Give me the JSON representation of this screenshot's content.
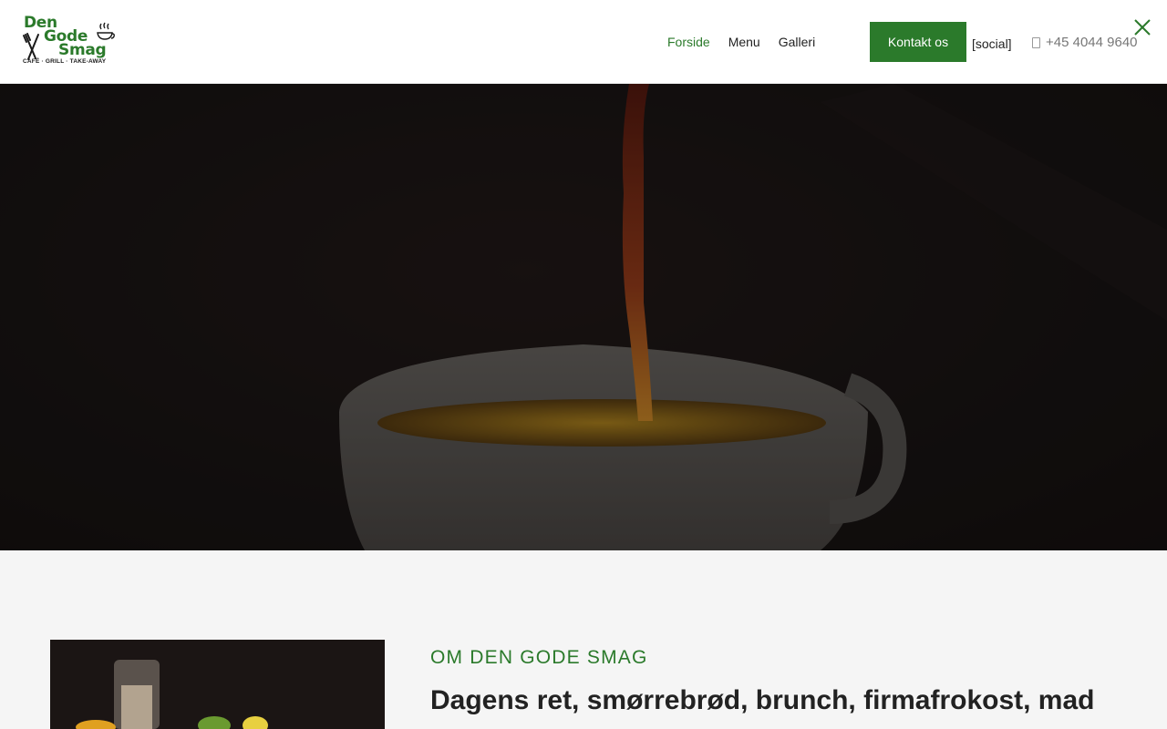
{
  "brand": {
    "logo_lines": [
      "Den",
      "Gode",
      "Smag"
    ],
    "logo_tagline": "CAFÉ · GRILL · TAKE-AWAY",
    "logo_color": "#2b7a2b"
  },
  "nav": {
    "items": [
      {
        "label": "Forside",
        "active": true
      },
      {
        "label": "Menu",
        "active": false
      },
      {
        "label": "Galleri",
        "active": false
      }
    ]
  },
  "header": {
    "contact_label": "Kontakt os",
    "social_label": "[social]",
    "phone": "+45 4044 9640",
    "phone_icon": "phone-icon",
    "close_icon": "close-icon"
  },
  "hero": {
    "image": "coffee-pour-image"
  },
  "about": {
    "eyebrow": "OM DEN GODE SMAG",
    "title": "Dagens ret, smørrebrød, brunch, firmafrokost, mad"
  },
  "colors": {
    "accent": "#2b7a2b",
    "header_bg": "#ffffff",
    "page_bg": "#f5f5f5"
  }
}
